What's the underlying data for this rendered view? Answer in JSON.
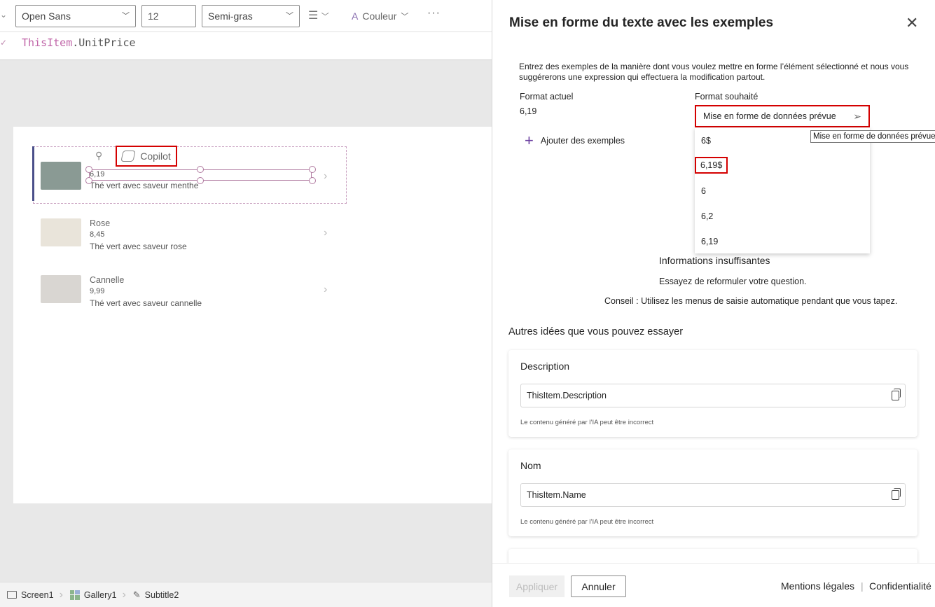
{
  "toolbar": {
    "font_family": "Open Sans",
    "font_size": "12",
    "font_weight": "Semi-gras",
    "color_label": "Couleur",
    "more": "···"
  },
  "formula": {
    "object": "ThisItem",
    "property": ".UnitPrice"
  },
  "gallery": {
    "items": [
      {
        "name": "",
        "price": "6,19",
        "description": "Thé vert avec saveur menthe",
        "thumb_color": "#8a9a94"
      },
      {
        "name": "Rose",
        "price": "8,45",
        "description": "Thé vert avec saveur rose",
        "thumb_color": "#e9e4da"
      },
      {
        "name": "Cannelle",
        "price": "9,99",
        "description": "Thé vert avec saveur cannelle",
        "thumb_color": "#d9d6d2"
      }
    ],
    "copilot_label": "Copilot"
  },
  "statusbar": {
    "crumbs": [
      "Screen1",
      "Gallery1",
      "Subtitle2"
    ]
  },
  "panel": {
    "title": "Mise en forme du texte avec les exemples",
    "intro": "Entrez des exemples de la manière dont vous voulez mettre en forme l’élément sélectionné et nous vous suggérerons une expression qui effectuera la modification partout.",
    "current_label": "Format actuel",
    "current_value": "6,19",
    "desired_label": "Format souhaité",
    "desired_value": "Mise en forme de données prévue",
    "tooltip": "Mise en forme de données prévue",
    "add_examples": "Ajouter des exemples",
    "dropdown": [
      "6$",
      "6,19$",
      "6",
      "6,2",
      "6,19"
    ],
    "info_title": "Informations insuffisantes",
    "info_line1": "Essayez de reformuler votre question.",
    "info_line2": "Conseil : Utilisez les menus de saisie automatique pendant que vous tapez.",
    "others_title": "Autres idées que vous pouvez essayer",
    "cards": [
      {
        "title": "Description",
        "formula": "ThisItem.Description",
        "note": "Le contenu généré par l’IA peut être incorrect"
      },
      {
        "title": "Nom",
        "formula": "ThisItem.Name",
        "note": "Le contenu généré par l’IA peut être incorrect"
      }
    ],
    "footer": {
      "apply": "Appliquer",
      "cancel": "Annuler",
      "legal": "Mentions légales",
      "privacy": "Confidentialité"
    }
  }
}
